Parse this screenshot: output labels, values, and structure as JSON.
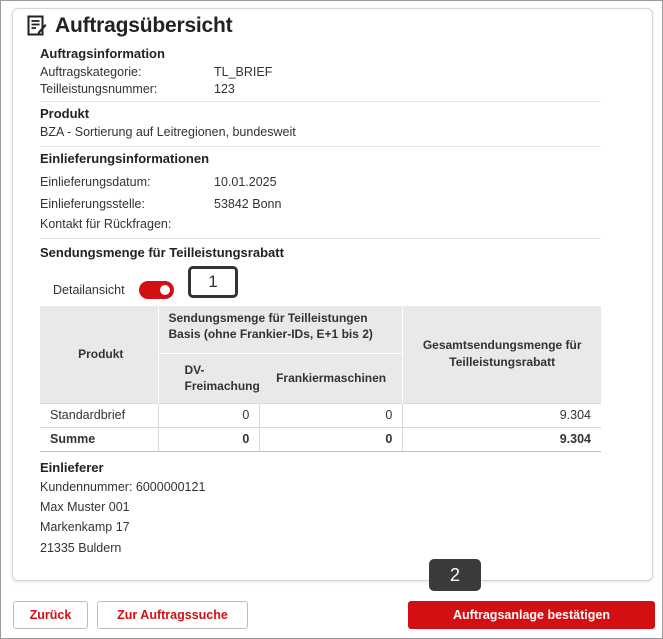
{
  "page": {
    "title": "Auftragsübersicht"
  },
  "auftrag": {
    "heading": "Auftragsinformation",
    "kategorie_label": "Auftragskategorie:",
    "kategorie_value": "TL_BRIEF",
    "nummer_label": "Teilleistungsnummer:",
    "nummer_value": "123"
  },
  "produkt": {
    "heading": "Produkt",
    "description": "BZA - Sortierung auf Leitregionen, bundesweit"
  },
  "einlieferung": {
    "heading": "Einlieferungsinformationen",
    "datum_label": "Einlieferungsdatum:",
    "datum_value": "10.01.2025",
    "stelle_label": "Einlieferungsstelle:",
    "stelle_value": "53842 Bonn",
    "kontakt_label": "Kontakt für Rückfragen:"
  },
  "sendungsmenge": {
    "heading": "Sendungsmenge für Teilleistungsrabatt",
    "toggle_label": "Detailansicht",
    "toggle_on": true,
    "table": {
      "col_produkt": "Produkt",
      "col_group_line1": "Sendungsmenge für Teilleistungen",
      "col_group_line2": "Basis (ohne Frankier-IDs, E+1 bis 2)",
      "col_dv_line1": "DV-",
      "col_dv_line2": "Freimachung",
      "col_fm": "Frankiermaschinen",
      "col_total_line1": "Gesamtsendungsmenge für",
      "col_total_line2": "Teilleistungsrabatt",
      "rows": [
        {
          "produkt": "Standardbrief",
          "dv": "0",
          "fm": "0",
          "total": "9.304"
        }
      ],
      "sum": {
        "produkt": "Summe",
        "dv": "0",
        "fm": "0",
        "total": "9.304"
      }
    }
  },
  "einlieferer": {
    "heading": "Einlieferer",
    "kundennummer": "Kundennummer: 6000000121",
    "name": "Max Muster 001",
    "street": "Markenkamp 17",
    "city": "21335 Buldern"
  },
  "badges": {
    "one": "1",
    "two": "2"
  },
  "buttons": {
    "back": "Zurück",
    "search": "Zur Auftragssuche",
    "confirm": "Auftragsanlage bestätigen"
  },
  "colors": {
    "accent": "#d40f14",
    "table_header": "#e9e9e9"
  }
}
